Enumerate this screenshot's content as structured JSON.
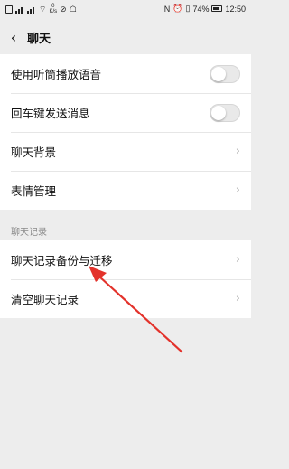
{
  "status_bar": {
    "left_text": "K/s",
    "speed_value": "0",
    "battery": "74%",
    "time": "12:50",
    "icons": [
      "sim-icon",
      "signal-icon",
      "signal-icon",
      "wifi-icon",
      "speed-icon",
      "muted-icon",
      "cat-icon",
      "nfc-icon",
      "alarm-icon",
      "vibrate-icon",
      "battery-icon"
    ]
  },
  "header": {
    "title": "聊天"
  },
  "settings": {
    "items": [
      {
        "label": "使用听筒播放语音",
        "control": "toggle",
        "value": "off"
      },
      {
        "label": "回车键发送消息",
        "control": "toggle",
        "value": "off"
      },
      {
        "label": "聊天背景",
        "control": "chevron"
      },
      {
        "label": "表情管理",
        "control": "chevron"
      }
    ]
  },
  "chat_history": {
    "section_label": "聊天记录",
    "items": [
      {
        "label": "聊天记录备份与迁移",
        "control": "chevron"
      },
      {
        "label": "清空聊天记录",
        "control": "chevron"
      }
    ]
  },
  "annotation": {
    "arrow_color": "#e3322b"
  }
}
